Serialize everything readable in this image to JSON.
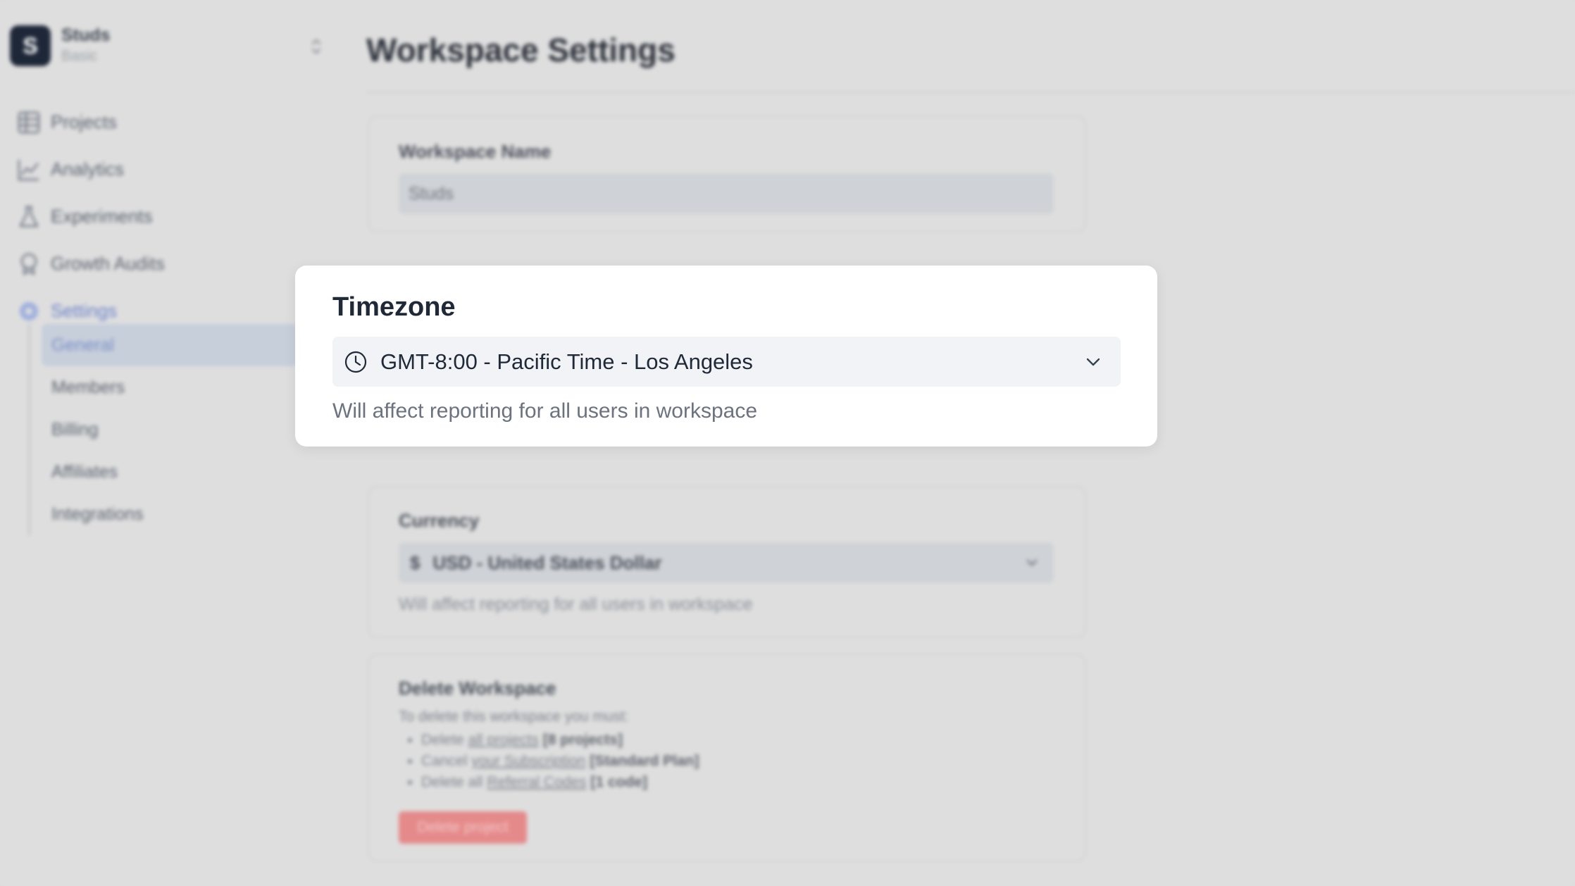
{
  "workspace": {
    "avatar_letter": "S",
    "name": "Studs",
    "plan": "Basic"
  },
  "sidebar": {
    "items": [
      {
        "label": "Projects",
        "icon": "grid-icon"
      },
      {
        "label": "Analytics",
        "icon": "chart-line-icon"
      },
      {
        "label": "Experiments",
        "icon": "flask-icon"
      },
      {
        "label": "Growth Audits",
        "icon": "badge-icon"
      },
      {
        "label": "Settings",
        "icon": "gear-icon"
      }
    ],
    "settings_subitems": [
      {
        "label": "General"
      },
      {
        "label": "Members"
      },
      {
        "label": "Billing"
      },
      {
        "label": "Affiliates"
      },
      {
        "label": "Integrations"
      }
    ]
  },
  "page": {
    "title": "Workspace Settings"
  },
  "workspace_name_card": {
    "label": "Workspace Name",
    "value": "Studs"
  },
  "currency_card": {
    "label": "Currency",
    "symbol": "$",
    "value": "USD - United States Dollar",
    "help": "Will affect reporting for all users in workspace"
  },
  "delete_card": {
    "label": "Delete Workspace",
    "intro": "To delete this workspace you must:",
    "items": [
      {
        "pre": "Delete",
        "link": "all projects",
        "tag": "[8 projects]"
      },
      {
        "pre": "Cancel",
        "link": "your Subscription",
        "tag": "[Standard Plan]"
      },
      {
        "pre": "Delete all",
        "link": "Referral Codes",
        "tag": "[1 code]"
      }
    ],
    "button": "Delete project"
  },
  "timezone_modal": {
    "title": "Timezone",
    "value": "GMT-8:00 - Pacific Time - Los Angeles",
    "help": "Will affect reporting for all users in workspace"
  },
  "colors": {
    "accent": "#6b83c9",
    "danger": "#e58a8a",
    "modal_bg": "#ffffff",
    "select_bg": "#f1f3f7"
  }
}
